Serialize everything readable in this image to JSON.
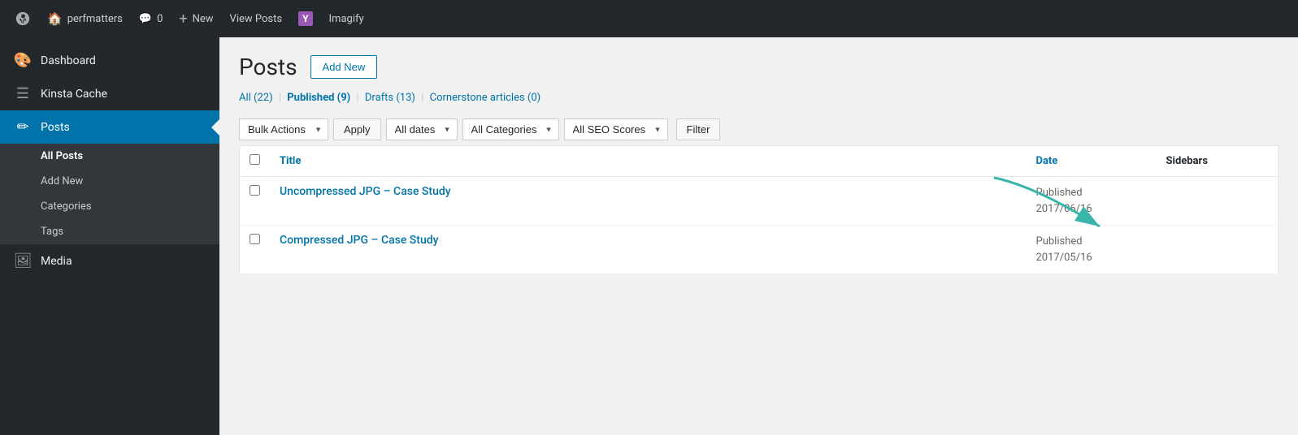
{
  "adminbar": {
    "items": [
      {
        "id": "wp-logo",
        "label": "WordPress",
        "icon": "⊕"
      },
      {
        "id": "site-name",
        "label": "perfmatters",
        "icon": "🏠"
      },
      {
        "id": "comments",
        "label": "0",
        "icon": "💬"
      },
      {
        "id": "new",
        "label": "New",
        "icon": "+"
      },
      {
        "id": "view-posts",
        "label": "View Posts",
        "icon": ""
      },
      {
        "id": "yoast",
        "label": "",
        "icon": "Y"
      },
      {
        "id": "imagify",
        "label": "Imagify",
        "icon": ""
      }
    ]
  },
  "sidebar": {
    "items": [
      {
        "id": "dashboard",
        "label": "Dashboard",
        "icon": "🎨"
      },
      {
        "id": "kinsta-cache",
        "label": "Kinsta Cache",
        "icon": "☰"
      },
      {
        "id": "posts",
        "label": "Posts",
        "icon": "✏",
        "active": true
      }
    ],
    "submenu": [
      {
        "id": "all-posts",
        "label": "All Posts",
        "active": true
      },
      {
        "id": "add-new",
        "label": "Add New"
      },
      {
        "id": "categories",
        "label": "Categories"
      },
      {
        "id": "tags",
        "label": "Tags"
      }
    ],
    "media": {
      "label": "Media",
      "icon": "🖼"
    }
  },
  "page": {
    "title": "Posts",
    "add_new_label": "Add New"
  },
  "filter_links": [
    {
      "id": "all",
      "label": "All",
      "count": "(22)",
      "active": false
    },
    {
      "id": "published",
      "label": "Published",
      "count": "(9)",
      "active": true
    },
    {
      "id": "drafts",
      "label": "Drafts",
      "count": "(13)",
      "active": false
    },
    {
      "id": "cornerstone",
      "label": "Cornerstone articles",
      "count": "(0)",
      "active": false
    }
  ],
  "toolbar": {
    "bulk_actions_label": "Bulk Actions",
    "apply_label": "Apply",
    "all_dates_label": "All dates",
    "all_categories_label": "All Categories",
    "all_seo_scores_label": "All SEO Scores",
    "filter_label": "Filter"
  },
  "table": {
    "columns": [
      {
        "id": "cb",
        "label": ""
      },
      {
        "id": "title",
        "label": "Title"
      },
      {
        "id": "date",
        "label": "Date"
      },
      {
        "id": "sidebars",
        "label": "Sidebars"
      }
    ],
    "rows": [
      {
        "id": "row1",
        "title": "Uncompressed JPG – Case Study",
        "date_status": "Published",
        "date_value": "2017/06/16"
      },
      {
        "id": "row2",
        "title": "Compressed JPG – Case Study",
        "date_status": "Published",
        "date_value": "2017/05/16"
      }
    ]
  },
  "arrow": {
    "color": "#3ab5ac"
  }
}
